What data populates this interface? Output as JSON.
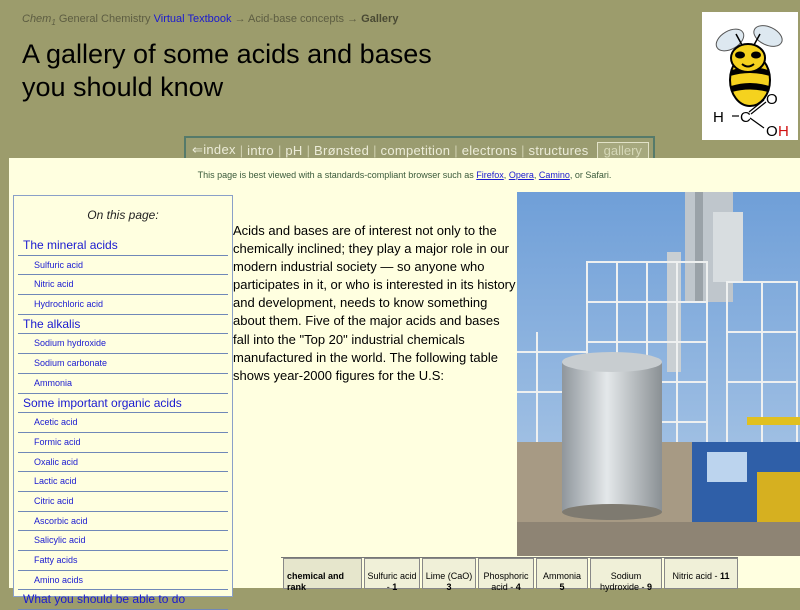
{
  "breadcrumb": {
    "chem": "Chem",
    "chem_sub": "1",
    "general": "General Chemistry",
    "textbook": "Virtual Textbook",
    "arrow": "→",
    "concepts": "Acid-base concepts",
    "current": "Gallery"
  },
  "title_line1": "A gallery of some acids and bases",
  "title_line2": "you should know",
  "logo": {
    "h": "H",
    "c": "C",
    "o1": "O",
    "o2": "O",
    "oh_h": "H"
  },
  "nav": {
    "index": "⇐index",
    "intro": "intro",
    "ph": "pH",
    "bronsted": "Brønsted",
    "competition": "competition",
    "electrons": "electrons",
    "structures": "structures",
    "gallery": "gallery",
    "sep": "|"
  },
  "note": {
    "prefix": "This page is best viewed with a standards-compliant browser such as",
    "firefox": "Firefox",
    "opera": "Opera",
    "camino": "Camino",
    "suffix": ", or Safari."
  },
  "toc": {
    "title": "On this page:",
    "rows": [
      {
        "label": "The mineral acids",
        "kind": "sec"
      },
      {
        "label": "Sulfuric acid",
        "kind": "sub"
      },
      {
        "label": "Nitric acid",
        "kind": "sub"
      },
      {
        "label": "Hydrochloric acid",
        "kind": "sub"
      },
      {
        "label": "The alkalis",
        "kind": "sec"
      },
      {
        "label": "Sodium hydroxide",
        "kind": "sub"
      },
      {
        "label": "Sodium carbonate",
        "kind": "sub"
      },
      {
        "label": "Ammonia",
        "kind": "sub"
      },
      {
        "label": "Some important organic acids",
        "kind": "sec"
      },
      {
        "label": "Acetic acid",
        "kind": "sub"
      },
      {
        "label": "Formic acid",
        "kind": "sub"
      },
      {
        "label": "Oxalic acid",
        "kind": "sub"
      },
      {
        "label": "Lactic acid",
        "kind": "sub"
      },
      {
        "label": "Citric acid",
        "kind": "sub"
      },
      {
        "label": "Ascorbic acid",
        "kind": "sub"
      },
      {
        "label": "Salicylic acid",
        "kind": "sub"
      },
      {
        "label": "Fatty acids",
        "kind": "sub"
      },
      {
        "label": "Amino acids",
        "kind": "sub"
      },
      {
        "label": "What you should be able to do",
        "kind": "sec"
      }
    ]
  },
  "intro": "Acids and bases are of interest not only to the chemically inclined; they play a major role in our modern industrial society — so anyone who participates in it, or who is interested in its history and development, needs to know something about them. Five of the major acids and bases fall into the \"Top 20\" industrial chemicals manufactured in the world. The following table shows year-2000 figures for the U.S:",
  "table": {
    "header": "chemical and rank",
    "cells": [
      {
        "name": "Sulfuric acid -",
        "rank": "1"
      },
      {
        "name": "Lime (CaO)",
        "rank": "3"
      },
      {
        "name": "Phosphoric acid -",
        "rank": "4"
      },
      {
        "name": "Ammonia",
        "rank": "5"
      },
      {
        "name": "Sodium hydroxide -",
        "rank": "9"
      },
      {
        "name": "Nitric acid -",
        "rank": "11"
      }
    ]
  }
}
